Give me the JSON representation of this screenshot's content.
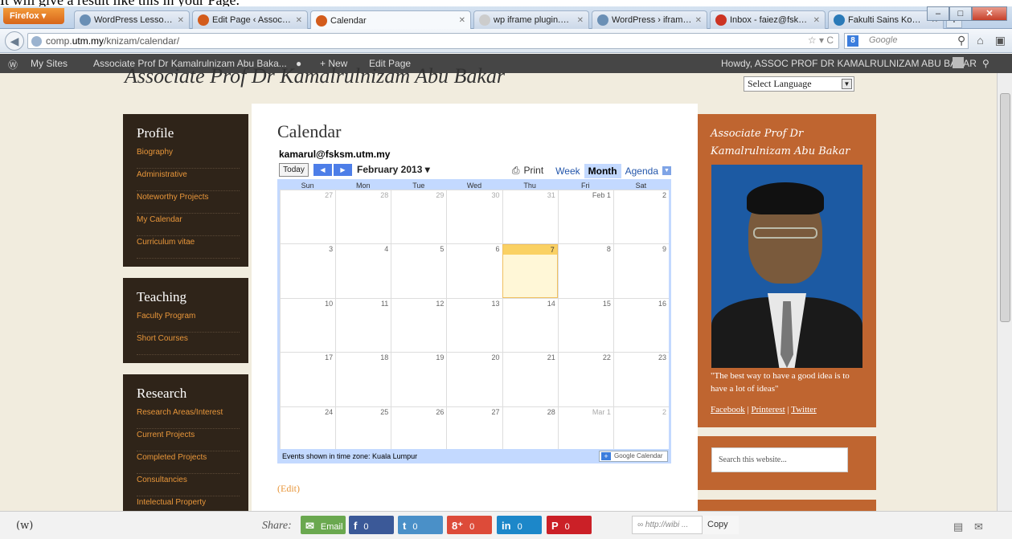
{
  "caption": "It will give a result like this in your Page.",
  "browser": {
    "app_button": "Firefox",
    "tabs": [
      {
        "title": "WordPress Lessons ...",
        "color": "#6a8fb5"
      },
      {
        "title": "Edit Page ‹ Associat...",
        "color": "#d35c1c"
      },
      {
        "title": "Calendar",
        "color": "#d35c1c"
      },
      {
        "title": "wp iframe plugin.pn...",
        "color": "#cccccc"
      },
      {
        "title": "WordPress › iframe ...",
        "color": "#6a8fb5"
      },
      {
        "title": "Inbox - faiez@fsksm...",
        "color": "#cc3322"
      },
      {
        "title": "Fakulti Sains Kompu...",
        "color": "#2a7ab8"
      }
    ],
    "url_prefix": "comp.",
    "url_domain": "utm.my",
    "url_path": "/knizam/calendar/",
    "search_placeholder": "Google"
  },
  "adminbar": {
    "my_sites": "My Sites",
    "site_name": "Associate Prof Dr Kamalrulnizam Abu Baka...",
    "new": "+ New",
    "edit_page": "Edit Page",
    "howdy": "Howdy, ASSOC PROF DR KAMALRULNIZAM ABU BAKAR"
  },
  "site": {
    "title_cut": "Associate Prof Dr Kamalrulnizam Abu Bakar",
    "select_language": "Select Language"
  },
  "left_widgets": [
    {
      "heading": "Profile",
      "links": [
        "Biography",
        "Administrative",
        "Noteworthy Projects",
        "My Calendar",
        "Curriculum vitae"
      ]
    },
    {
      "heading": "Teaching",
      "links": [
        "Faculty Program",
        "Short Courses"
      ]
    },
    {
      "heading": "Research",
      "links": [
        "Research Areas/Interest",
        "Current Projects",
        "Completed Projects",
        "Consultancies",
        "Intelectual Property"
      ]
    }
  ],
  "main": {
    "page_title": "Calendar",
    "calendar_owner": "kamarul@fsksm.utm.my",
    "today_btn": "Today",
    "month_label": "February 2013",
    "print": "Print",
    "view_week": "Week",
    "view_month": "Month",
    "view_agenda": "Agenda",
    "days": [
      "Sun",
      "Mon",
      "Tue",
      "Wed",
      "Thu",
      "Fri",
      "Sat"
    ],
    "weeks": [
      [
        {
          "d": "27",
          "o": true
        },
        {
          "d": "28",
          "o": true
        },
        {
          "d": "29",
          "o": true
        },
        {
          "d": "30",
          "o": true
        },
        {
          "d": "31",
          "o": true
        },
        {
          "d": "Feb 1"
        },
        {
          "d": "2"
        }
      ],
      [
        {
          "d": "3"
        },
        {
          "d": "4"
        },
        {
          "d": "5"
        },
        {
          "d": "6"
        },
        {
          "d": "7",
          "today": true
        },
        {
          "d": "8"
        },
        {
          "d": "9"
        }
      ],
      [
        {
          "d": "10"
        },
        {
          "d": "11"
        },
        {
          "d": "12"
        },
        {
          "d": "13"
        },
        {
          "d": "14"
        },
        {
          "d": "15"
        },
        {
          "d": "16"
        }
      ],
      [
        {
          "d": "17"
        },
        {
          "d": "18"
        },
        {
          "d": "19"
        },
        {
          "d": "20"
        },
        {
          "d": "21"
        },
        {
          "d": "22"
        },
        {
          "d": "23"
        }
      ],
      [
        {
          "d": "24"
        },
        {
          "d": "25"
        },
        {
          "d": "26"
        },
        {
          "d": "27"
        },
        {
          "d": "28"
        },
        {
          "d": "Mar 1",
          "o": true
        },
        {
          "d": "2",
          "o": true
        }
      ]
    ],
    "timezone_note": "Events shown in time zone: Kuala Lumpur",
    "gcal_badge": "Google Calendar",
    "edit_link": "(Edit)"
  },
  "right_sidebar": {
    "name_line1": "Associate Prof Dr",
    "name_line2": "Kamalrulnizam Abu Bakar",
    "quote": "\"The best way to have a good idea is to have a lot of ideas\"",
    "facebook": "Facebook",
    "pinterest": "Printerest",
    "twitter": "Twitter",
    "search_placeholder": "Search this website..."
  },
  "sharebar": {
    "logo": "(w)",
    "share_label": "Share:",
    "email": "Email",
    "facebook_count": "0",
    "twitter_count": "0",
    "gplus_count": "0",
    "linkedin_count": "0",
    "pinterest_count": "0",
    "shortlink": "http://wibi ...",
    "copy": "Copy",
    "colors": {
      "email": "#6aa84f",
      "facebook": "#3b5998",
      "twitter": "#4a90c8",
      "gplus": "#dd4b39",
      "linkedin": "#1c87c9",
      "pinterest": "#cb2027"
    }
  }
}
